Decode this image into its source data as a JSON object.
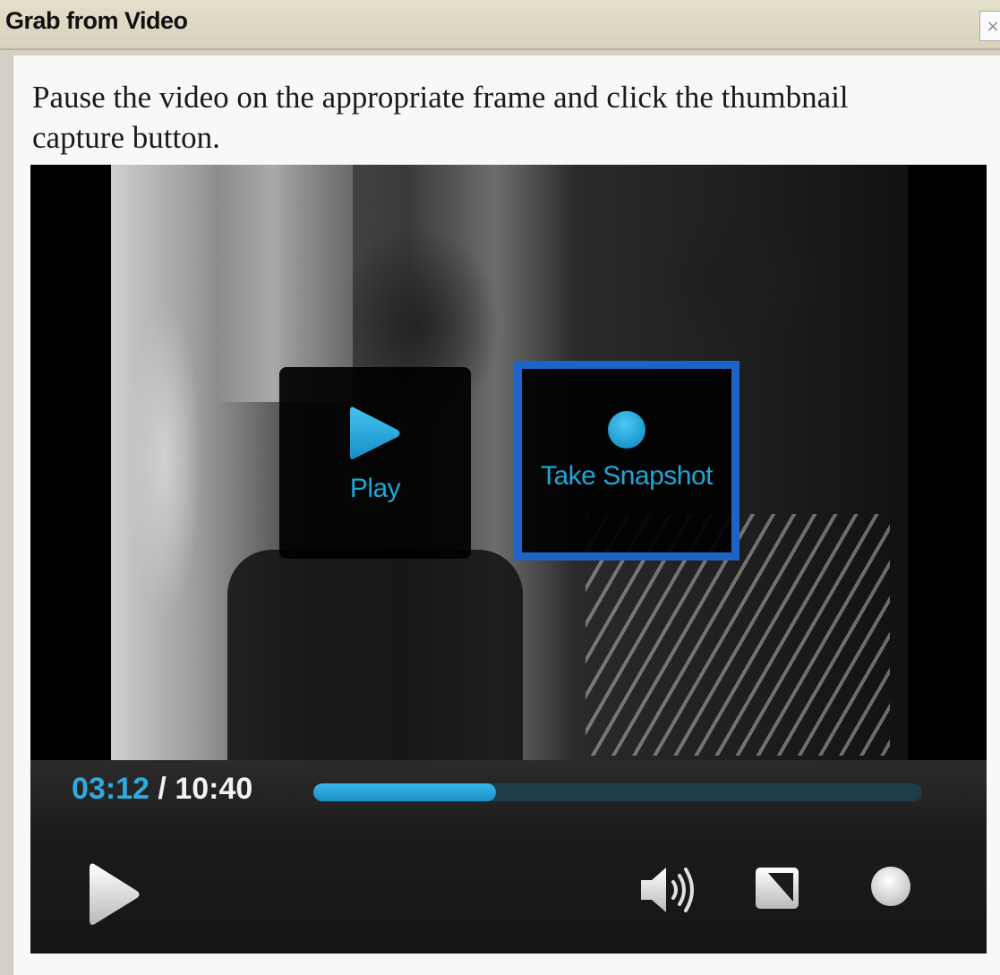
{
  "window": {
    "title": "Grab from Video",
    "close_label": "×"
  },
  "instruction": "Pause the video on the appropriate frame and click the thumbnail capture button.",
  "overlay": {
    "play_label": "Play",
    "snapshot_label": "Take Snapshot"
  },
  "controls": {
    "current_time": "03:12",
    "separator": " / ",
    "duration": "10:40",
    "progress": 0.3,
    "icons": [
      "play-icon",
      "volume-icon",
      "fullscreen-icon",
      "snapshot-icon"
    ]
  },
  "colors": {
    "accent": "#2fa9df",
    "highlight_border": "#1e63c6"
  }
}
